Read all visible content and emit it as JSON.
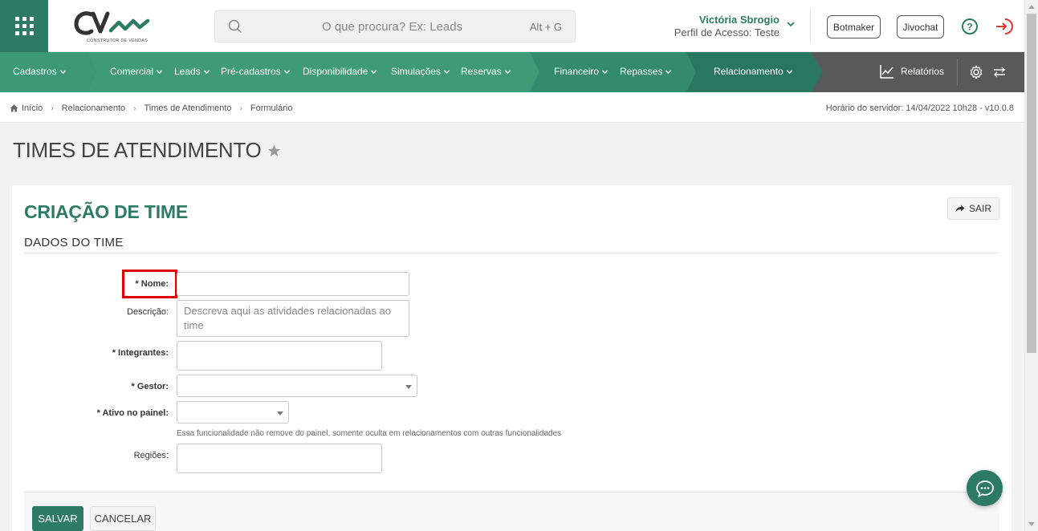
{
  "colors": {
    "brand": "#2e7b63",
    "nav_dark": "#595959",
    "highlight": "#e00000"
  },
  "header": {
    "logo_subtext": "CONSTRUTOR DE VENDAS",
    "search_placeholder": "O que procura? Ex: Leads",
    "search_shortcut": "Alt + G",
    "user_name": "Victória Sbrogio",
    "user_profile": "Perfil de Acesso: Teste",
    "botmaker_label": "Botmaker",
    "jivochat_label": "Jivochat"
  },
  "nav": {
    "items": [
      "Cadastros",
      "Comercial",
      "Leads",
      "Pré-cadastros",
      "Disponibilidade",
      "Simulações",
      "Reservas",
      "Financeiro",
      "Repasses",
      "Relacionamento"
    ],
    "reports_label": "Relatórios"
  },
  "breadcrumb": {
    "items": [
      "Início",
      "Relacionamento",
      "Times de Atendimento",
      "Formulário"
    ],
    "server_time": "Horário do servidor: 14/04/2022 10h28 - v10.0.8"
  },
  "page": {
    "title": "TIMES DE ATENDIMENTO"
  },
  "form": {
    "card_title": "CRIAÇÃO DE TIME",
    "exit_label": "SAIR",
    "section_title": "DADOS DO TIME",
    "fields": {
      "name_label": "* Nome:",
      "description_label": "Descrição:",
      "description_placeholder": "Descreva aqui as atividades relacionadas ao time",
      "members_label": "* Integrantes:",
      "manager_label": "* Gestor:",
      "active_label": "* Ativo no painel:",
      "active_help": "Essa funcionalidade não remove do painel, somente oculta em relacionamentos com outras funcionalidades",
      "regions_label": "Regiões:"
    },
    "save_label": "SALVAR",
    "cancel_label": "CANCELAR"
  },
  "icons": [
    "grid-icon",
    "search-icon",
    "chevron-down-icon",
    "help-icon",
    "logout-icon",
    "chart-icon",
    "gear-icon",
    "swap-icon",
    "home-icon",
    "star-icon",
    "share-icon",
    "chat-icon"
  ]
}
